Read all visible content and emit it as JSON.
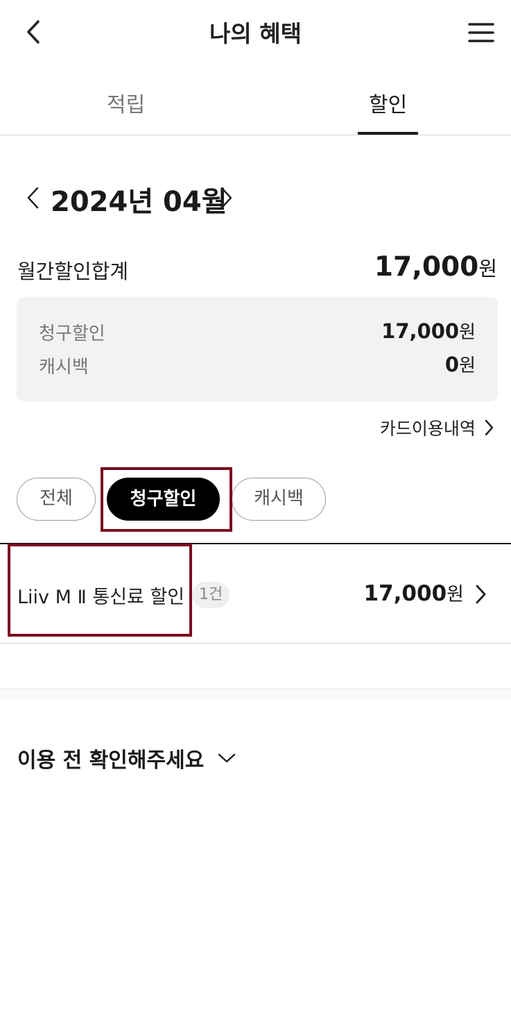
{
  "header": {
    "title": "나의 혜택",
    "back_icon": "chevron-left-icon",
    "menu_icon": "hamburger-menu-icon"
  },
  "tabs": [
    {
      "label": "적립",
      "active": false
    },
    {
      "label": "할인",
      "active": true
    }
  ],
  "month_selector": {
    "label": "2024년 04월",
    "prev_icon": "chevron-left-icon",
    "next_icon": "chevron-right-icon"
  },
  "monthly_total": {
    "label": "월간할인합계",
    "amount": "17,000",
    "unit": "원"
  },
  "summary": [
    {
      "label": "청구할인",
      "amount": "17,000",
      "unit": "원"
    },
    {
      "label": "캐시백",
      "amount": "0",
      "unit": "원"
    }
  ],
  "usage_link": {
    "label": "카드이용내역",
    "icon": "chevron-right-icon"
  },
  "filters": [
    {
      "label": "전체",
      "selected": false
    },
    {
      "label": "청구할인",
      "selected": true
    },
    {
      "label": "캐시백",
      "selected": false
    }
  ],
  "list": [
    {
      "name": "Liiv M Ⅱ 통신료 할인",
      "count": "1건",
      "amount": "17,000",
      "unit": "원"
    }
  ],
  "notice": {
    "title": "이용 전 확인해주세요",
    "icon": "chevron-down-icon"
  },
  "colors": {
    "highlight": "#7b0a1f",
    "chip_selected_bg": "#000000",
    "summary_bg": "#f2f2f2"
  }
}
